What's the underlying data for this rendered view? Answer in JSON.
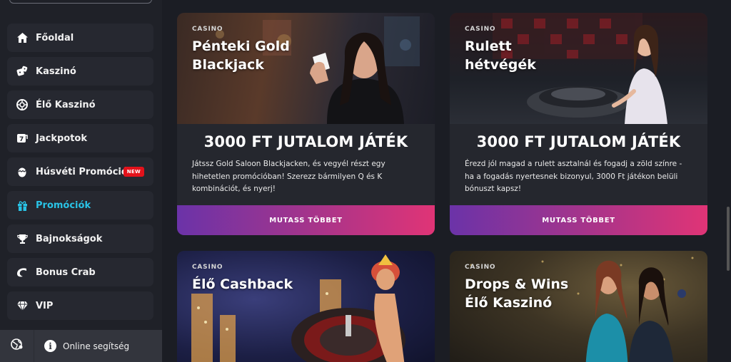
{
  "sidebar": {
    "items": [
      {
        "label": "Főoldal",
        "icon": "home-icon"
      },
      {
        "label": "Kaszinó",
        "icon": "dice-icon"
      },
      {
        "label": "Élő Kaszinó",
        "icon": "chip-icon"
      },
      {
        "label": "Jackpotok",
        "icon": "slot-icon"
      },
      {
        "label": "Húsvéti Promóció",
        "icon": "egg-icon",
        "badge": "NEW"
      },
      {
        "label": "Promóciók",
        "icon": "gift-icon",
        "active": true
      },
      {
        "label": "Bajnokságok",
        "icon": "trophy-icon"
      },
      {
        "label": "Bonus Crab",
        "icon": "crab-icon"
      },
      {
        "label": "VIP",
        "icon": "diamond-icon"
      }
    ],
    "help_label": "Online segítség"
  },
  "colors": {
    "accent": "#29c3e6",
    "badge": "#e3121b",
    "button_start": "#6b33a8",
    "button_end": "#e03476"
  },
  "cards": [
    {
      "tag": "CASINO",
      "title_line1": "Pénteki Gold",
      "title_line2": "Blackjack",
      "headline": "3000 FT JUTALOM JÁTÉK",
      "description": "Játssz Gold Saloon Blackjacken, és vegyél részt egy hihetetlen promócióban! Szerezz bármilyen Q és K kombinációt, és nyerj!",
      "button": "MUTASS TÖBBET"
    },
    {
      "tag": "CASINO",
      "title_line1": "Rulett",
      "title_line2": "hétvégék",
      "headline": "3000 FT JUTALOM JÁTÉK",
      "description": "Érezd jól magad a rulett asztalnál és fogadj a zöld színre - ha a fogadás nyertesnek bizonyul, 3000 Ft játékon belüli bónuszt kapsz!",
      "button": "MUTASS TÖBBET"
    },
    {
      "tag": "CASINO",
      "title_line1": "Élő Cashback",
      "title_line2": ""
    },
    {
      "tag": "CASINO",
      "title_line1": "Drops & Wins",
      "title_line2": "Élő Kaszinó"
    }
  ]
}
